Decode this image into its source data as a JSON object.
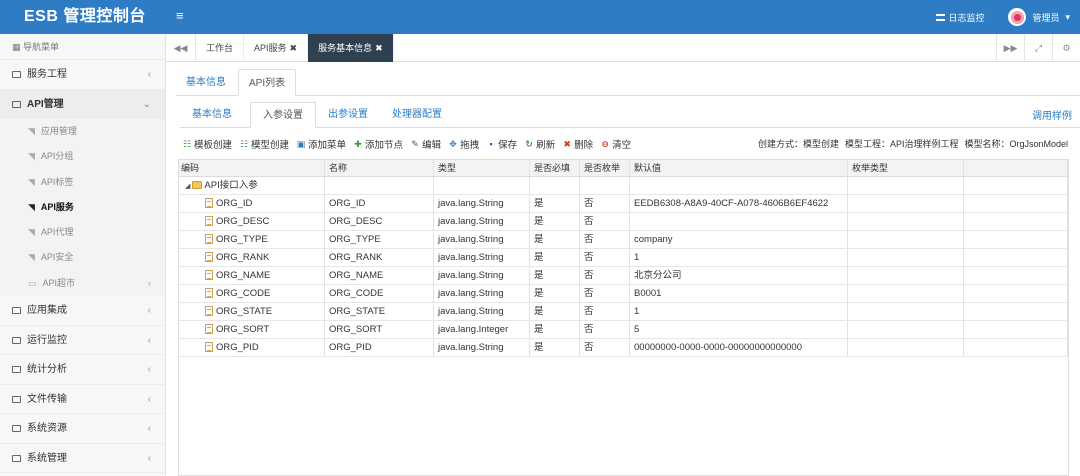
{
  "app": {
    "logo": "ESB 管理控制台",
    "menu_icon": "≡",
    "log_monitor": "日志监控",
    "user": "管理员"
  },
  "sidebar": {
    "header": "导航菜单",
    "items": [
      {
        "label": "服务工程"
      },
      {
        "label": "API管理"
      },
      {
        "label": "应用集成"
      },
      {
        "label": "运行监控"
      },
      {
        "label": "统计分析"
      },
      {
        "label": "文件传输"
      },
      {
        "label": "系统资源"
      },
      {
        "label": "系统管理"
      }
    ],
    "api_sub": [
      "应用管理",
      "API分组",
      "API标签",
      "API服务",
      "API代理",
      "API安全",
      "API超市"
    ]
  },
  "tabs": {
    "items": [
      "工作台",
      "API服务",
      "服务基本信息"
    ]
  },
  "outer_tabs": [
    "基本信息",
    "API列表"
  ],
  "inner_tabs": [
    "基本信息",
    "入参设置",
    "出参设置",
    "处理器配置"
  ],
  "sample_link": "调用样例",
  "toolbar": [
    "模板创建",
    "模型创建",
    "添加菜单",
    "添加节点",
    "编辑",
    "拖拽",
    "保存",
    "刷新",
    "删除",
    "清空"
  ],
  "meta": {
    "create_mode": "创建方式：模型创建",
    "model_project": "模型工程：API治理样例工程",
    "model_name": "模型名称：OrgJsonModel"
  },
  "grid": {
    "columns": [
      "编码",
      "名称",
      "类型",
      "是否必填",
      "是否枚举",
      "默认值",
      "枚举类型",
      ""
    ],
    "root": "API接口入参",
    "rows": [
      [
        "ORG_ID",
        "ORG_ID",
        "java.lang.String",
        "是",
        "否",
        "EEDB6308-A8A9-40CF-A078-4606B6EF4622",
        ""
      ],
      [
        "ORG_DESC",
        "ORG_DESC",
        "java.lang.String",
        "是",
        "否",
        "",
        ""
      ],
      [
        "ORG_TYPE",
        "ORG_TYPE",
        "java.lang.String",
        "是",
        "否",
        "company",
        ""
      ],
      [
        "ORG_RANK",
        "ORG_RANK",
        "java.lang.String",
        "是",
        "否",
        "1",
        ""
      ],
      [
        "ORG_NAME",
        "ORG_NAME",
        "java.lang.String",
        "是",
        "否",
        "北京分公司",
        ""
      ],
      [
        "ORG_CODE",
        "ORG_CODE",
        "java.lang.String",
        "是",
        "否",
        "B0001",
        ""
      ],
      [
        "ORG_STATE",
        "ORG_STATE",
        "java.lang.String",
        "是",
        "否",
        "1",
        ""
      ],
      [
        "ORG_SORT",
        "ORG_SORT",
        "java.lang.Integer",
        "是",
        "否",
        "5",
        ""
      ],
      [
        "ORG_PID",
        "ORG_PID",
        "java.lang.String",
        "是",
        "否",
        "00000000-0000-0000-00000000000000",
        ""
      ]
    ]
  },
  "colors": {
    "topbar": "#2d7cc4",
    "active_tab": "#2f4050",
    "link": "#2d7cc4"
  }
}
